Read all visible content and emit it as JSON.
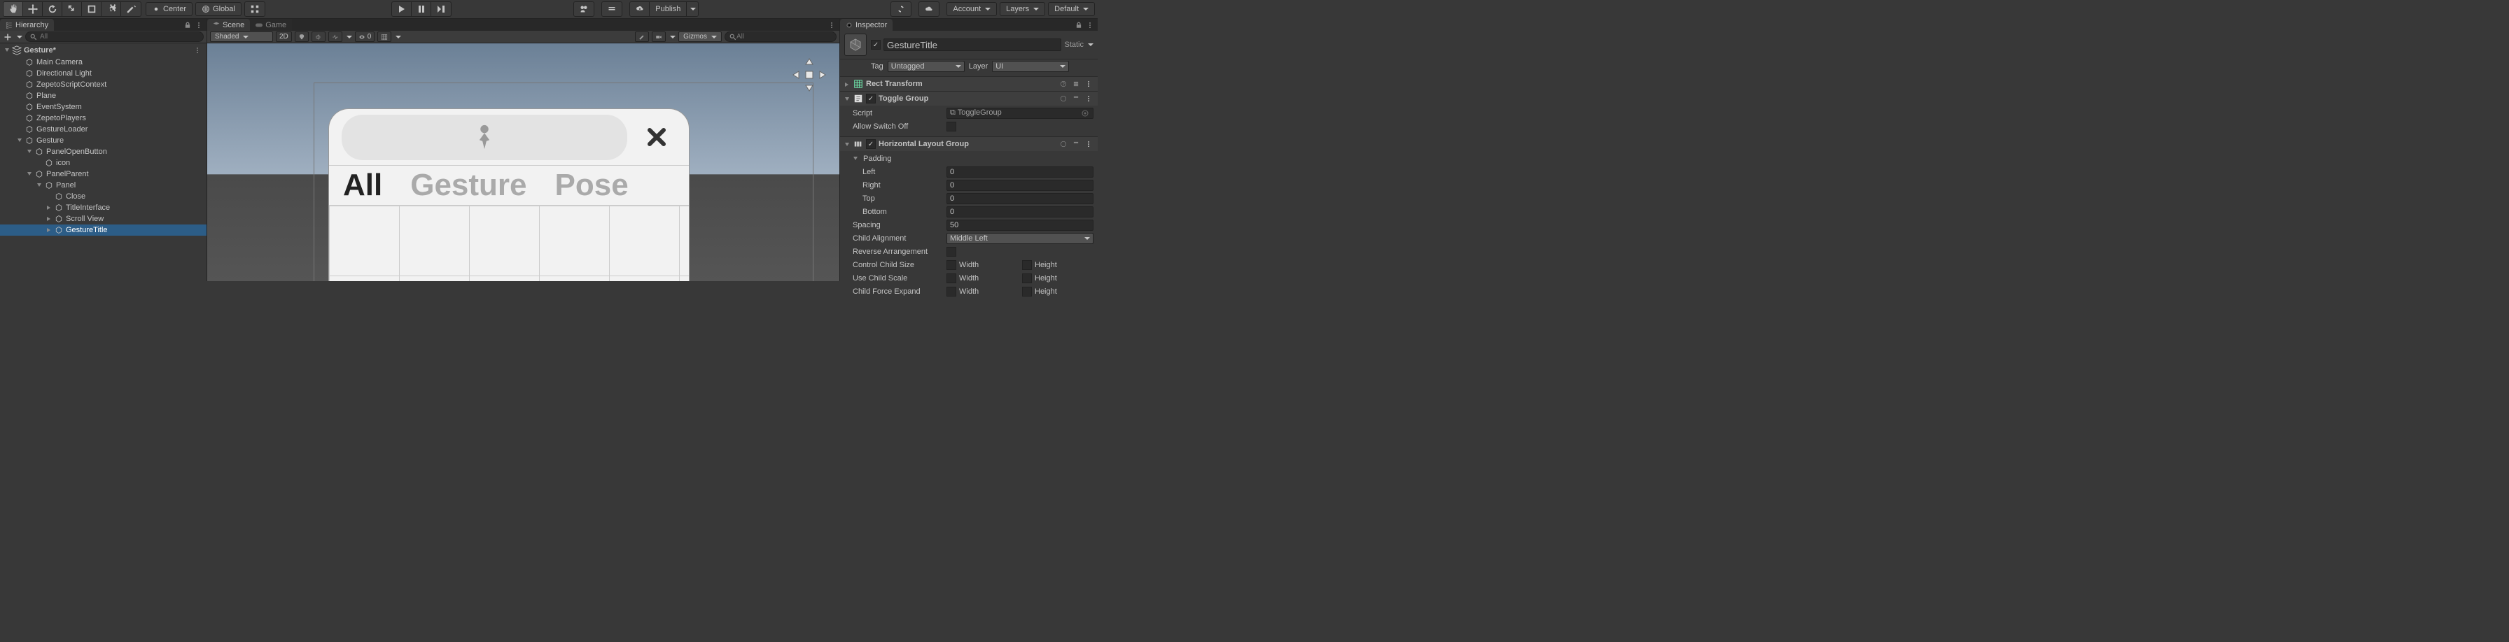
{
  "toolbar": {
    "center_label": "Center",
    "global_label": "Global",
    "publish_label": "Publish",
    "account_label": "Account",
    "layers_label": "Layers",
    "layout_label": "Default"
  },
  "hierarchy": {
    "tab_label": "Hierarchy",
    "search_placeholder": "All",
    "scene_name": "Gesture*",
    "items": [
      {
        "label": "Main Camera",
        "indent": 1
      },
      {
        "label": "Directional Light",
        "indent": 1
      },
      {
        "label": "ZepetoScriptContext",
        "indent": 1
      },
      {
        "label": "Plane",
        "indent": 1
      },
      {
        "label": "EventSystem",
        "indent": 1
      },
      {
        "label": "ZepetoPlayers",
        "indent": 1
      },
      {
        "label": "GestureLoader",
        "indent": 1
      },
      {
        "label": "Gesture",
        "indent": 1,
        "fold": true
      },
      {
        "label": "PanelOpenButton",
        "indent": 2,
        "fold": true
      },
      {
        "label": "icon",
        "indent": 3
      },
      {
        "label": "PanelParent",
        "indent": 2,
        "fold": true
      },
      {
        "label": "Panel",
        "indent": 3,
        "fold": true
      },
      {
        "label": "Close",
        "indent": 4
      },
      {
        "label": "TitleInterface",
        "indent": 4,
        "children": true
      },
      {
        "label": "Scroll View",
        "indent": 4,
        "children": true
      },
      {
        "label": "GestureTitle",
        "indent": 4,
        "children": true,
        "selected": true
      }
    ]
  },
  "scene": {
    "tab_scene": "Scene",
    "tab_game": "Game",
    "shading": "Shaded",
    "mode_2d": "2D",
    "gizmos": "Gizmos",
    "search_placeholder": "All",
    "hidden_count": "0",
    "panel_tabs": {
      "all": "All",
      "gesture": "Gesture",
      "pose": "Pose"
    }
  },
  "inspector": {
    "tab_label": "Inspector",
    "name": "GestureTitle",
    "static_label": "Static",
    "tag_label": "Tag",
    "tag_value": "Untagged",
    "layer_label": "Layer",
    "layer_value": "UI",
    "rect_transform_label": "Rect Transform",
    "toggle_group": {
      "title": "Toggle Group",
      "script_label": "Script",
      "script_value": "ToggleGroup",
      "allow_switch_off_label": "Allow Switch Off"
    },
    "h_layout": {
      "title": "Horizontal Layout Group",
      "padding_label": "Padding",
      "left_label": "Left",
      "left_value": "0",
      "right_label": "Right",
      "right_value": "0",
      "top_label": "Top",
      "top_value": "0",
      "bottom_label": "Bottom",
      "bottom_value": "0",
      "spacing_label": "Spacing",
      "spacing_value": "50",
      "child_align_label": "Child Alignment",
      "child_align_value": "Middle Left",
      "reverse_label": "Reverse Arrangement",
      "control_size_label": "Control Child Size",
      "use_scale_label": "Use Child Scale",
      "force_expand_label": "Child Force Expand",
      "width_label": "Width",
      "height_label": "Height"
    }
  }
}
